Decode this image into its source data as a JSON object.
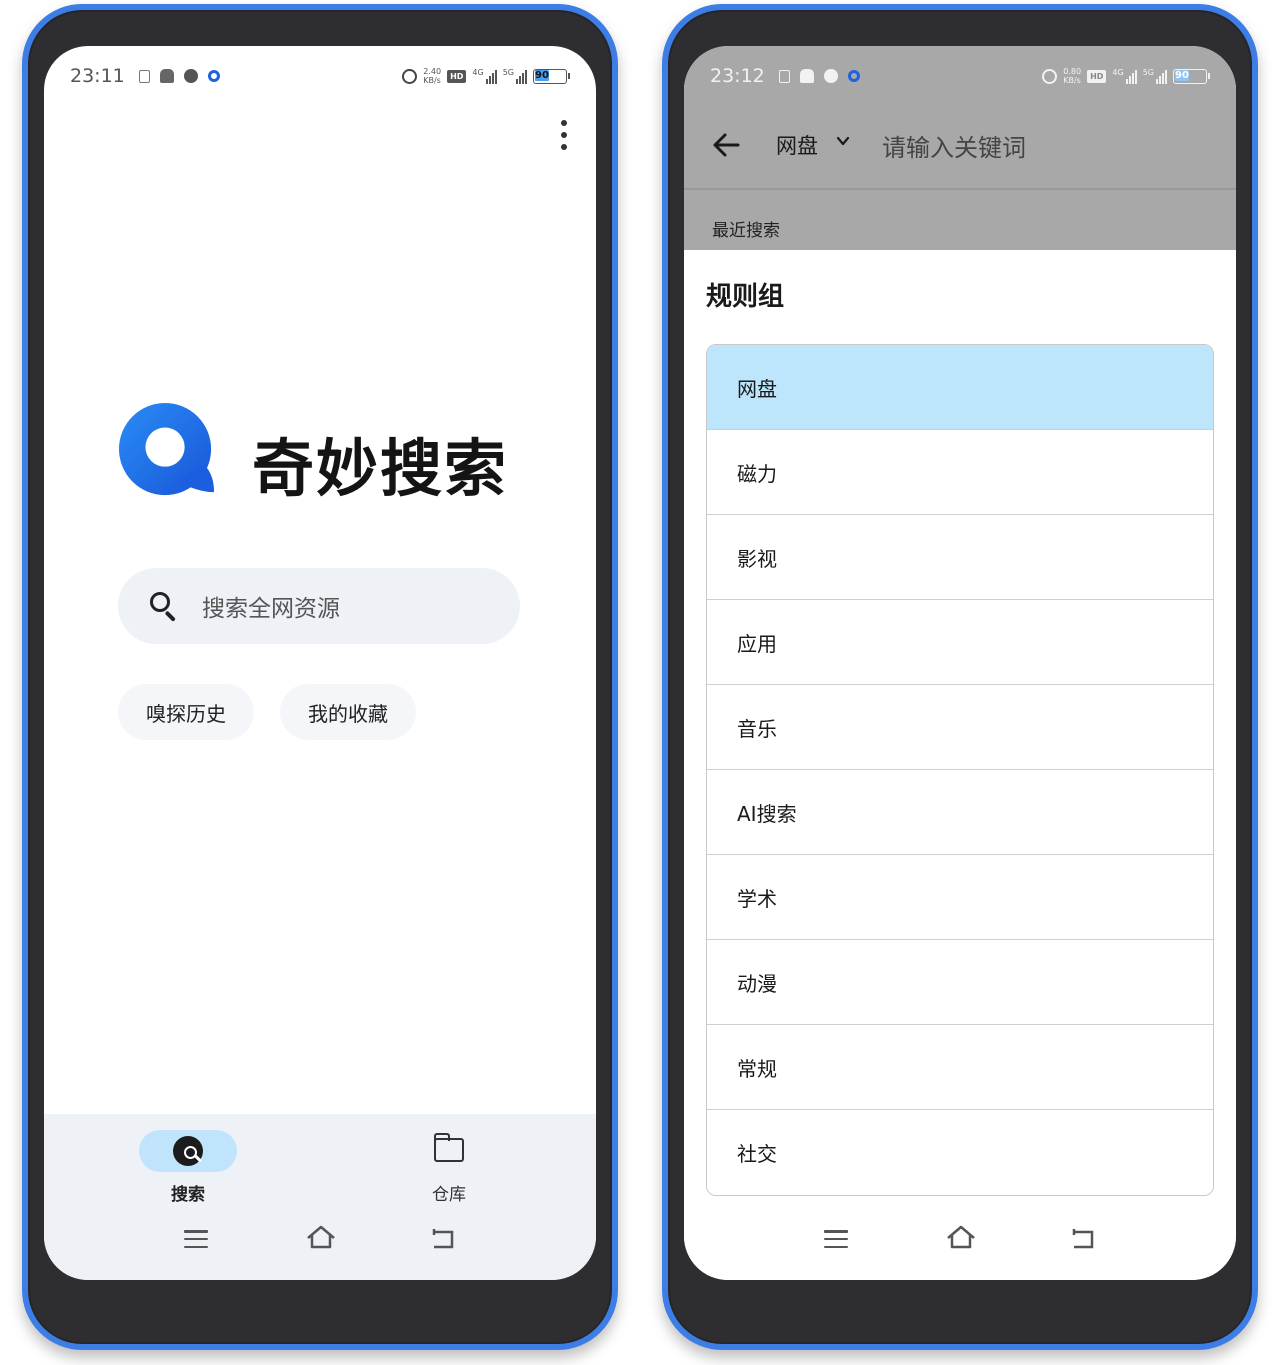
{
  "left_phone": {
    "status": {
      "time": "23:11",
      "speed_value": "2.40",
      "speed_unit": "KB/s",
      "net1": "4G",
      "net2": "5G",
      "battery": "90"
    },
    "brand_name": "奇妙搜索",
    "search_placeholder": "搜索全网资源",
    "chips": [
      "嗅探历史",
      "我的收藏"
    ],
    "bottom_nav": {
      "search_label": "搜索",
      "repo_label": "仓库"
    }
  },
  "right_phone": {
    "status": {
      "time": "23:12",
      "speed_value": "0.80",
      "speed_unit": "KB/s",
      "net1": "4G",
      "net2": "5G",
      "battery": "90"
    },
    "toolbar": {
      "category": "网盘",
      "input_placeholder": "请输入关键词"
    },
    "recent_label": "最近搜索",
    "sheet_title": "规则组",
    "groups": [
      "网盘",
      "磁力",
      "影视",
      "应用",
      "音乐",
      "AI搜索",
      "学术",
      "动漫",
      "常规",
      "社交"
    ],
    "selected_group": "网盘"
  },
  "colors": {
    "frame_accent": "#3d7ee6",
    "selected_item_bg": "#bde6fc",
    "nav_active_bg": "#bfe4fb",
    "logo_blue": "#1e6fe6"
  }
}
